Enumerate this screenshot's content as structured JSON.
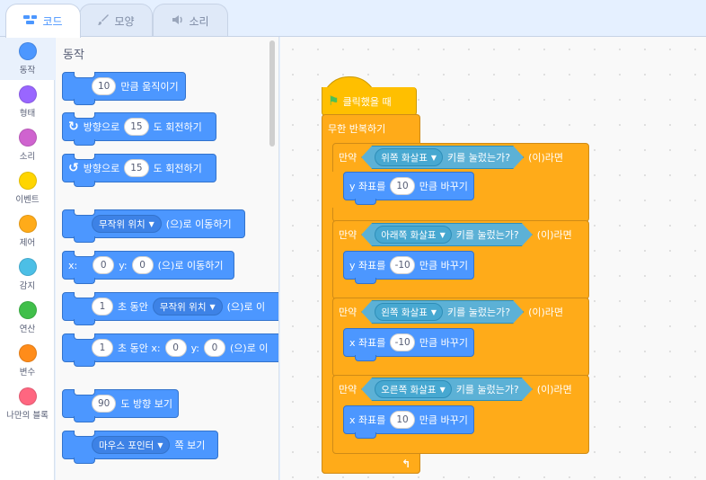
{
  "tabs": [
    {
      "label": "코드",
      "icon": "code-icon"
    },
    {
      "label": "모양",
      "icon": "brush-icon"
    },
    {
      "label": "소리",
      "icon": "speaker-icon"
    }
  ],
  "categories": [
    {
      "label": "동작",
      "color": "#4c97ff"
    },
    {
      "label": "형태",
      "color": "#9966ff"
    },
    {
      "label": "소리",
      "color": "#cf63cf"
    },
    {
      "label": "이벤트",
      "color": "#ffd500"
    },
    {
      "label": "제어",
      "color": "#ffab19"
    },
    {
      "label": "감지",
      "color": "#4cbfe6"
    },
    {
      "label": "연산",
      "color": "#40bf4a"
    },
    {
      "label": "변수",
      "color": "#ff8c1a"
    },
    {
      "label": "나만의 블록",
      "color": "#ff6680"
    }
  ],
  "palette": {
    "title": "동작",
    "move": {
      "value": "10",
      "text": "만큼 움직이기"
    },
    "turn_right": {
      "prefix": "방향으로",
      "value": "15",
      "suffix": "도 회전하기"
    },
    "turn_left": {
      "prefix": "방향으로",
      "value": "15",
      "suffix": "도 회전하기"
    },
    "goto": {
      "option": "무작위 위치",
      "suffix": "(으)로 이동하기"
    },
    "goto_xy": {
      "x_label": "x:",
      "x": "0",
      "y_label": "y:",
      "y": "0",
      "suffix": "(으)로 이동하기"
    },
    "glide": {
      "secs": "1",
      "mid": "초 동안",
      "option": "무작위 위치",
      "suffix": "(으)로 이"
    },
    "glide_xy": {
      "secs": "1",
      "mid": "초 동안 x:",
      "x": "0",
      "y_label": "y:",
      "y": "0",
      "suffix": "(으)로 이"
    },
    "point": {
      "value": "90",
      "suffix": "도 방향 보기"
    },
    "point_towards": {
      "option": "마우스 포인터",
      "suffix": "쪽 보기"
    }
  },
  "script": {
    "hat_label": "클릭했을 때",
    "forever_label": "무한 반복하기",
    "if_label": "만약",
    "then_label": "(이)라면",
    "key_suffix": "키를 눌렀는가?",
    "ifs": [
      {
        "key": "위쪽 화살표",
        "axis": "y 좌표를",
        "value": "10",
        "suffix": "만큼 바꾸기"
      },
      {
        "key": "아래쪽 화살표",
        "axis": "y 좌표를",
        "value": "-10",
        "suffix": "만큼 바꾸기"
      },
      {
        "key": "왼쪽 화살표",
        "axis": "x 좌표를",
        "value": "-10",
        "suffix": "만큼 바꾸기"
      },
      {
        "key": "오른쪽 화살표",
        "axis": "x 좌표를",
        "value": "10",
        "suffix": "만큼 바꾸기"
      }
    ]
  }
}
